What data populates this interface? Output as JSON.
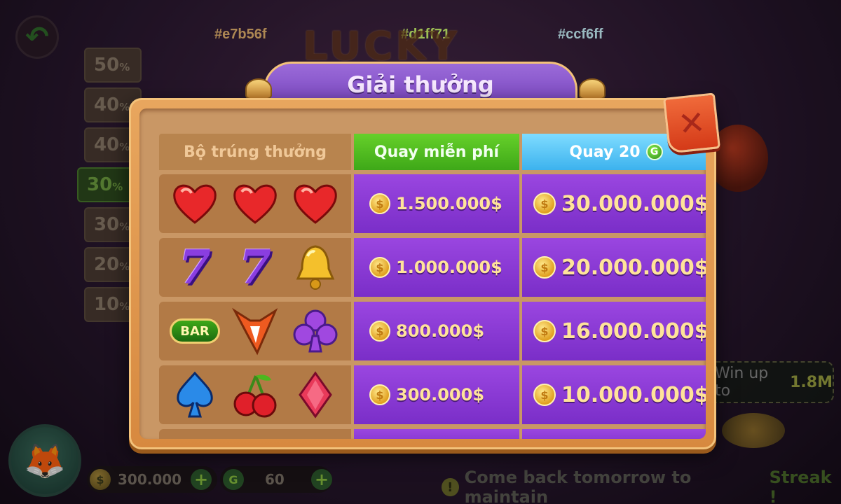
{
  "background": {
    "hex_labels": [
      {
        "text": "#e7b56f",
        "color": "#e7b56f"
      },
      {
        "text": "#d1ff71",
        "color": "#d1ff71"
      },
      {
        "text": "#ccf6ff",
        "color": "#ccf6ff"
      }
    ],
    "logo_text": "LUCKY BONUS",
    "percent_tiers": [
      "50",
      "40",
      "40",
      "30",
      "30",
      "20",
      "10"
    ],
    "active_tier_index": 3,
    "percent_sign": "%",
    "win_up_to": {
      "prefix": "Win up to",
      "value": "1.8M"
    },
    "balance": {
      "coins": "300.000",
      "gems": "60"
    },
    "streak_message": {
      "text": "Come back tomorrow to maintain",
      "highlight": "Streak !"
    }
  },
  "dialog": {
    "title": "Giải thưởng",
    "close_label": "✕",
    "columns": {
      "combo": "Bộ trúng thưởng",
      "free_spin": "Quay miễn phí",
      "paid_spin": "Quay 20",
      "paid_spin_currency": "G"
    },
    "rows": [
      {
        "symbols": [
          "heart",
          "heart",
          "heart"
        ],
        "free": "1.500.000$",
        "paid": "30.000.000$"
      },
      {
        "symbols": [
          "seven",
          "seven",
          "bell"
        ],
        "free": "1.000.000$",
        "paid": "20.000.000$"
      },
      {
        "symbols": [
          "bar",
          "fox",
          "club"
        ],
        "free": "800.000$",
        "paid": "16.000.000$"
      },
      {
        "symbols": [
          "spade",
          "cherry",
          "diamond"
        ],
        "free": "300.000$",
        "paid": "10.000.000$"
      }
    ],
    "bar_text": "BAR",
    "seven_text": "7",
    "coin_symbol": "$"
  },
  "colors": {
    "free_header": "#4cb81e",
    "paid_header": "#4ab8f0",
    "prize_cell": "#8a3ad8",
    "prize_text": "#ffe39a",
    "panel": "#d7893f"
  }
}
